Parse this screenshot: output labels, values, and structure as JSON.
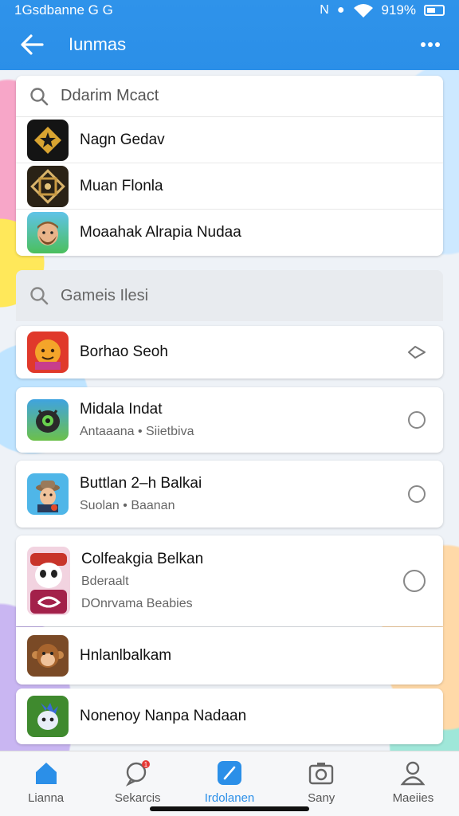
{
  "status_bar": {
    "left_text": "1Gsdbanne G G",
    "battery": "919%",
    "nfc": "N",
    "network": "●"
  },
  "toolbar": {
    "title": "Iunmas",
    "back_icon": "arrow-left-icon",
    "more_icon": "more-dots-icon"
  },
  "top_card": {
    "search_placeholder": "Ddarim Mcact",
    "apps": [
      {
        "name": "Nagn Gedav",
        "icon": "star-badge-icon"
      },
      {
        "name": "Muan Flonla",
        "icon": "knot-emblem-icon"
      },
      {
        "name": "Moaahak Alrapia Nudaa",
        "icon": "bearded-man-icon"
      }
    ]
  },
  "games_search": {
    "placeholder": "Gameis Ilesi"
  },
  "games": [
    {
      "title": "Borhao Seoh",
      "subtitle": "",
      "subtitle2": "",
      "icon": "orange-face-icon",
      "control": "chevron-icon"
    },
    {
      "title": "Midala Indat",
      "subtitle": "Antaaana • Siietbiva",
      "subtitle2": "",
      "icon": "robot-icon",
      "control": "radio"
    },
    {
      "title": "Buttlan 2–h Balkai",
      "subtitle": "Suolan • Baanan",
      "subtitle2": "",
      "icon": "cowboy-icon",
      "control": "radio"
    },
    {
      "title": "Colfeakgia Belkan",
      "subtitle": "Bderaalt",
      "subtitle2": "DOnrvama Beabies",
      "icon": "panda-icon",
      "control": "radio"
    },
    {
      "title": "Hnlanlbalkam",
      "subtitle": "",
      "subtitle2": "",
      "icon": "monkey-icon",
      "control": ""
    },
    {
      "title": "Nonenoy Nanpa Nadaan",
      "subtitle": "",
      "subtitle2": "",
      "icon": "blue-creature-icon",
      "control": ""
    }
  ],
  "bottom_nav": [
    {
      "label": "Lianna",
      "icon": "home-icon",
      "active": false
    },
    {
      "label": "Sekarcis",
      "icon": "chat-icon",
      "active": false,
      "badge": "1"
    },
    {
      "label": "Irdolanen",
      "icon": "pen-icon",
      "active": true
    },
    {
      "label": "Sany",
      "icon": "camera-icon",
      "active": false
    },
    {
      "label": "Maeiies",
      "icon": "person-icon",
      "active": false
    }
  ],
  "colors": {
    "accent": "#2b8fe8",
    "appbar": "#2f93ea",
    "badge": "#e53935"
  }
}
